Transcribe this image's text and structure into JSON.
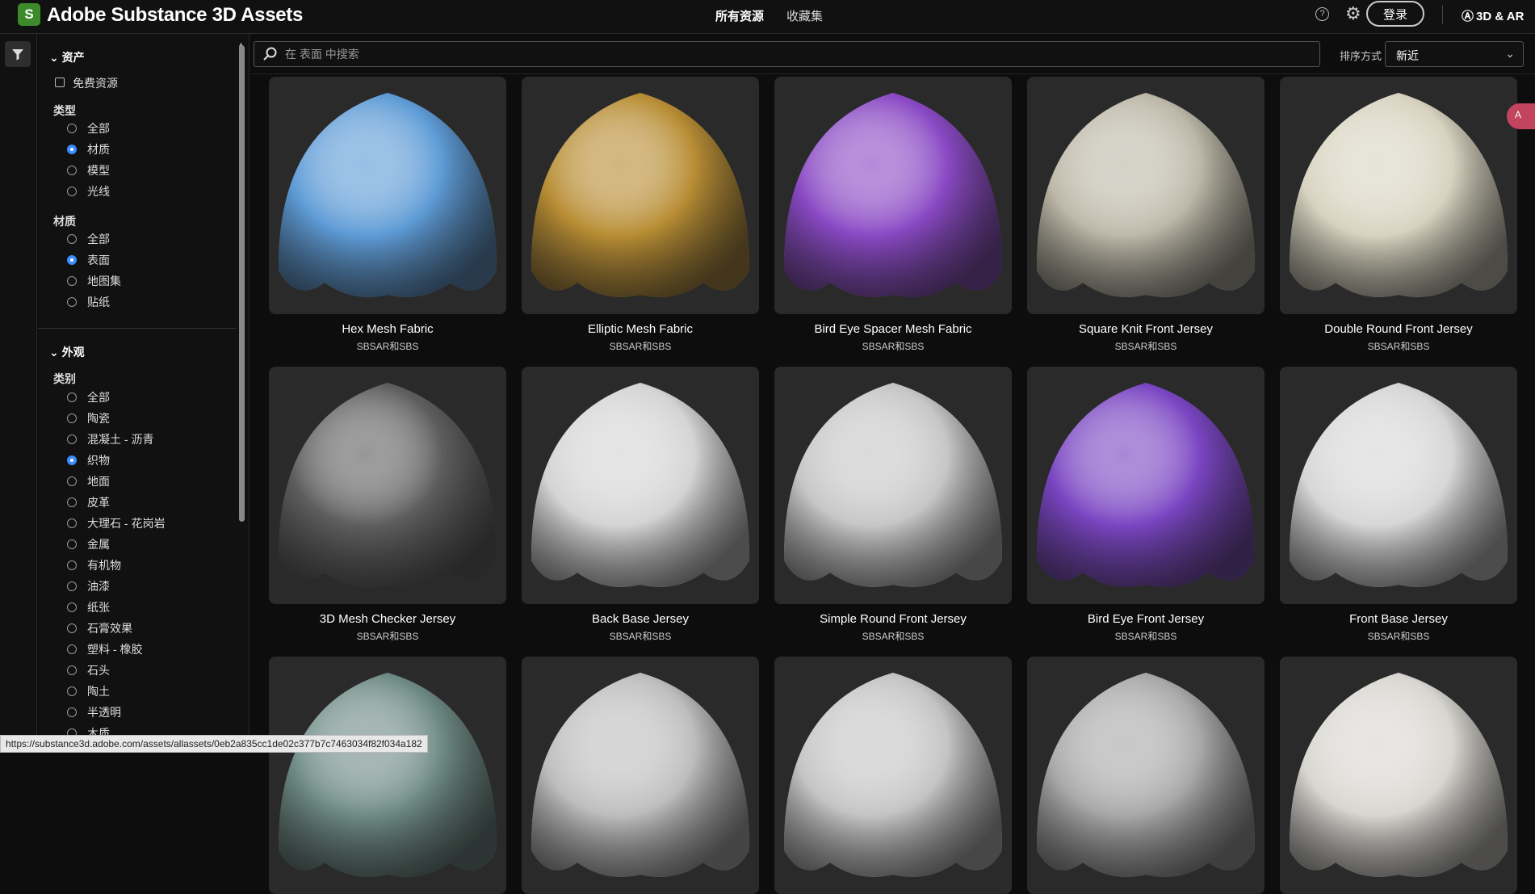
{
  "app": {
    "logo_letter": "S",
    "title": "Adobe Substance 3D Assets"
  },
  "nav": {
    "all": "所有资源",
    "favorites": "收藏集"
  },
  "header": {
    "help": "?",
    "login": "登录",
    "ar_label": "3D & AR"
  },
  "search": {
    "placeholder": "在 表面 中搜索"
  },
  "sort": {
    "label": "排序方式",
    "value": "新近"
  },
  "sidebar": {
    "assets_head": "资产",
    "free": "免费资源",
    "type_title": "类型",
    "type_options": [
      {
        "label": "全部",
        "checked": false
      },
      {
        "label": "材质",
        "checked": true
      },
      {
        "label": "模型",
        "checked": false
      },
      {
        "label": "光线",
        "checked": false
      }
    ],
    "material_title": "材质",
    "material_options": [
      {
        "label": "全部",
        "checked": false
      },
      {
        "label": "表面",
        "checked": true
      },
      {
        "label": "地图集",
        "checked": false
      },
      {
        "label": "贴纸",
        "checked": false
      }
    ],
    "appearance_head": "外观",
    "category_title": "类别",
    "category_options": [
      {
        "label": "全部",
        "checked": false
      },
      {
        "label": "陶瓷",
        "checked": false
      },
      {
        "label": "混凝土 - 沥青",
        "checked": false
      },
      {
        "label": "织物",
        "checked": true
      },
      {
        "label": "地面",
        "checked": false
      },
      {
        "label": "皮革",
        "checked": false
      },
      {
        "label": "大理石 - 花岗岩",
        "checked": false
      },
      {
        "label": "金属",
        "checked": false
      },
      {
        "label": "有机物",
        "checked": false
      },
      {
        "label": "油漆",
        "checked": false
      },
      {
        "label": "纸张",
        "checked": false
      },
      {
        "label": "石膏效果",
        "checked": false
      },
      {
        "label": "塑料 - 橡胶",
        "checked": false
      },
      {
        "label": "石头",
        "checked": false
      },
      {
        "label": "陶土",
        "checked": false
      },
      {
        "label": "半透明",
        "checked": false
      },
      {
        "label": "木质",
        "checked": false
      }
    ]
  },
  "cards": [
    {
      "title": "Hex Mesh Fabric",
      "format": "SBSAR和SBS",
      "color": "#5e9bd6"
    },
    {
      "title": "Elliptic Mesh Fabric",
      "format": "SBSAR和SBS",
      "color": "#b88d34"
    },
    {
      "title": "Bird Eye Spacer Mesh Fabric",
      "format": "SBSAR和SBS",
      "color": "#8a49c4"
    },
    {
      "title": "Square Knit Front Jersey",
      "format": "SBSAR和SBS",
      "color": "#bdb8a8"
    },
    {
      "title": "Double Round Front Jersey",
      "format": "SBSAR和SBS",
      "color": "#d8d3c0"
    },
    {
      "title": "3D Mesh Checker Jersey",
      "format": "SBSAR和SBS",
      "color": "#5e5e5e"
    },
    {
      "title": "Back Base Jersey",
      "format": "SBSAR和SBS",
      "color": "#d4d4d4"
    },
    {
      "title": "Simple Round Front Jersey",
      "format": "SBSAR和SBS",
      "color": "#c6c6c6"
    },
    {
      "title": "Bird Eye Front Jersey",
      "format": "SBSAR和SBS",
      "color": "#7a45c2"
    },
    {
      "title": "Front Base Jersey",
      "format": "SBSAR和SBS",
      "color": "#d6d6d6"
    },
    {
      "title": "",
      "format": "",
      "color": "#6e8a84"
    },
    {
      "title": "",
      "format": "",
      "color": "#bdbdbd"
    },
    {
      "title": "",
      "format": "",
      "color": "#c4c4c4"
    },
    {
      "title": "",
      "format": "",
      "color": "#a8a8a8"
    },
    {
      "title": "",
      "format": "",
      "color": "#d8d6d0"
    }
  ],
  "status_url": "https://substance3d.adobe.com/assets/allassets/0eb2a835cc1de02c377b7c7463034f82f034a182",
  "side_tab": "A"
}
